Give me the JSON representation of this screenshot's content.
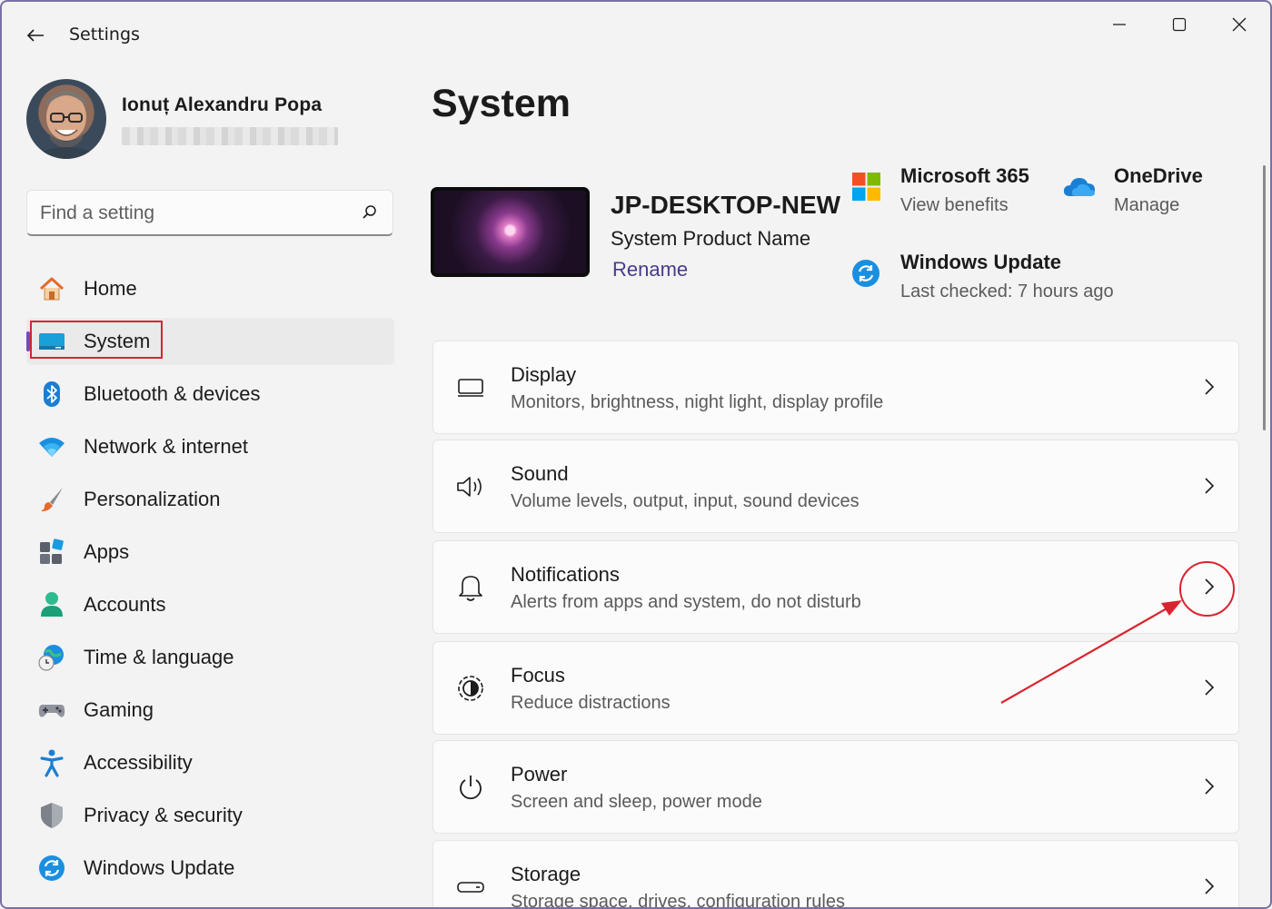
{
  "window": {
    "title": "Settings",
    "controls": {
      "minimize": "minimize",
      "maximize": "maximize",
      "close": "close"
    }
  },
  "profile": {
    "name": "Ionuț Alexandru Popa",
    "email_note": "email obscured"
  },
  "search": {
    "placeholder": "Find a setting",
    "value": ""
  },
  "nav": {
    "items": [
      {
        "label": "Home",
        "icon": "home-icon"
      },
      {
        "label": "System",
        "icon": "system-icon",
        "active": true
      },
      {
        "label": "Bluetooth & devices",
        "icon": "bluetooth-icon"
      },
      {
        "label": "Network & internet",
        "icon": "wifi-icon"
      },
      {
        "label": "Personalization",
        "icon": "brush-icon"
      },
      {
        "label": "Apps",
        "icon": "apps-icon"
      },
      {
        "label": "Accounts",
        "icon": "person-icon"
      },
      {
        "label": "Time & language",
        "icon": "globe-clock-icon"
      },
      {
        "label": "Gaming",
        "icon": "gamepad-icon"
      },
      {
        "label": "Accessibility",
        "icon": "accessibility-icon"
      },
      {
        "label": "Privacy & security",
        "icon": "shield-icon"
      },
      {
        "label": "Windows Update",
        "icon": "update-icon"
      }
    ]
  },
  "main": {
    "title": "System",
    "device": {
      "name": "JP-DESKTOP-NEW",
      "model": "System Product Name",
      "rename_label": "Rename"
    },
    "quick_links": {
      "m365": {
        "title": "Microsoft 365",
        "subtitle": "View benefits"
      },
      "onedrive": {
        "title": "OneDrive",
        "subtitle": "Manage"
      },
      "update": {
        "title": "Windows Update",
        "subtitle": "Last checked: 7 hours ago"
      }
    },
    "cards": [
      {
        "title": "Display",
        "subtitle": "Monitors, brightness, night light, display profile",
        "icon": "monitor-icon"
      },
      {
        "title": "Sound",
        "subtitle": "Volume levels, output, input, sound devices",
        "icon": "speaker-icon"
      },
      {
        "title": "Notifications",
        "subtitle": "Alerts from apps and system, do not disturb",
        "icon": "bell-icon"
      },
      {
        "title": "Focus",
        "subtitle": "Reduce distractions",
        "icon": "focus-icon"
      },
      {
        "title": "Power",
        "subtitle": "Screen and sleep, power mode",
        "icon": "power-icon"
      },
      {
        "title": "Storage",
        "subtitle": "Storage space, drives, configuration rules",
        "icon": "storage-icon"
      }
    ]
  },
  "colors": {
    "accent": "#6b4fbf",
    "annotation": "#d9242f",
    "background": "#f3f3f3",
    "card": "#fbfbfb"
  }
}
